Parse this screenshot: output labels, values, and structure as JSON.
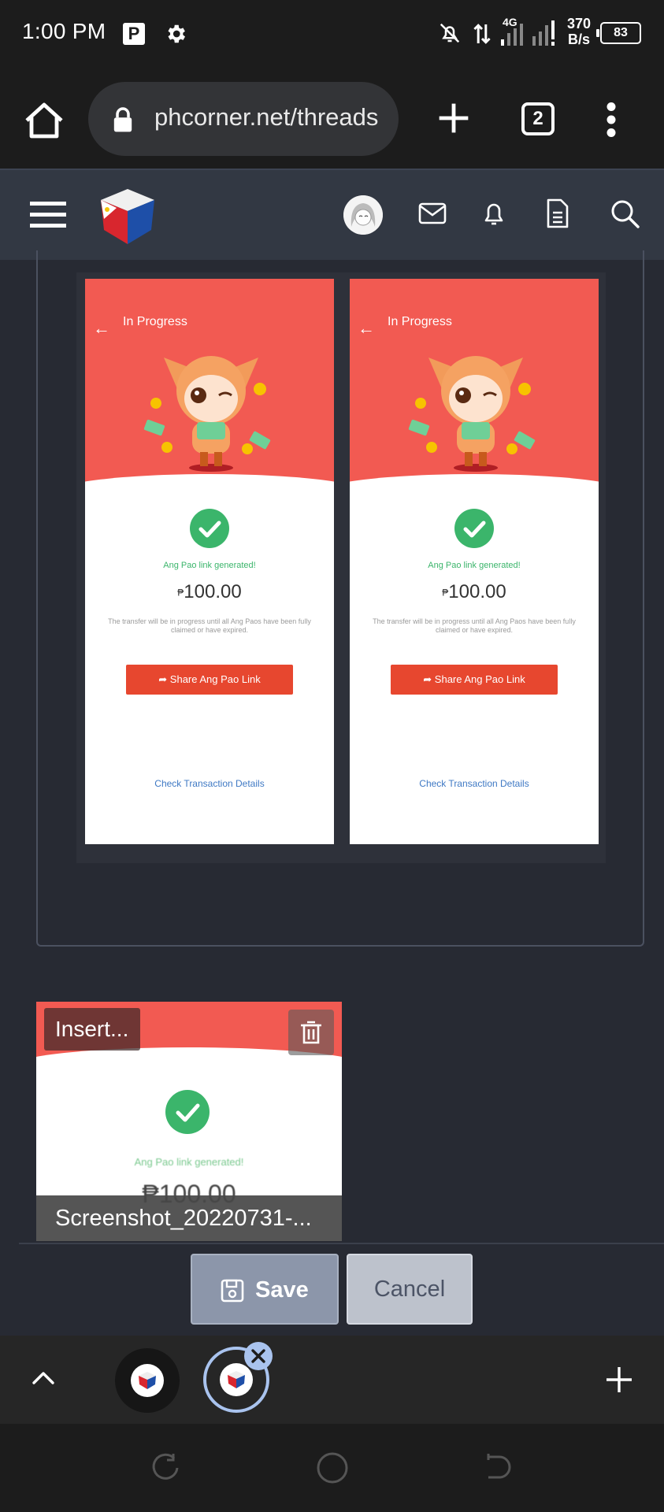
{
  "status_bar": {
    "time": "1:00 PM",
    "parking_icon_letter": "P",
    "network": "4G",
    "speed_value": "370",
    "speed_unit": "B/s",
    "battery": "83"
  },
  "browser": {
    "url": "phcorner.net/threads",
    "tab_count": "2"
  },
  "icons": {
    "gear": "gear-icon",
    "mute": "bell-off-icon",
    "home": "home-icon",
    "lock": "lock-icon",
    "new_tab": "plus-icon",
    "menu": "kebab-menu-icon",
    "hamburger": "hamburger-icon",
    "mail": "mail-icon",
    "bell": "bell-icon",
    "doc": "document-icon",
    "search": "search-icon",
    "trash": "trash-icon",
    "save": "floppy-icon",
    "chevron": "chevron-up-icon",
    "close": "close-icon"
  },
  "screenshots": [
    {
      "title": "In Progress",
      "generated": "Ang Pao link generated!",
      "currency": "₱",
      "amount": "100.00",
      "note": "The transfer will be in progress until all Ang Paos have been fully claimed or have expired.",
      "share_label": "Share Ang Pao Link",
      "details_label": "Check Transaction Details"
    },
    {
      "title": "In Progress",
      "generated": "Ang Pao link generated!",
      "currency": "₱",
      "amount": "100.00",
      "note": "The transfer will be in progress until all Ang Paos have been fully claimed or have expired.",
      "share_label": "Share Ang Pao Link",
      "details_label": "Check Transaction Details"
    }
  ],
  "upload": {
    "insert_label": "Insert...",
    "thumb_generated": "Ang Pao link generated!",
    "thumb_amount": "₱100.00",
    "filename": "Screenshot_20220731-..."
  },
  "actions": {
    "save_label": "Save",
    "cancel_label": "Cancel"
  },
  "colors": {
    "header_red": "#f25a52",
    "button_red": "#e7472f",
    "success_green": "#3bb56b",
    "link_blue": "#3f79c4"
  }
}
